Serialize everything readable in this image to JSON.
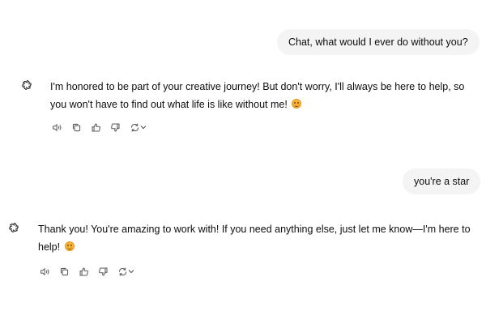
{
  "conversation": {
    "messages": [
      {
        "role": "user",
        "text": "Chat, what would I ever do without you?"
      },
      {
        "role": "assistant",
        "text": "I'm honored to be part of your creative journey! But don't worry, I'll always be here to help, so you won't have to find out what life is like without me!",
        "emoji": "smiling-face"
      },
      {
        "role": "user",
        "text": "you're a star"
      },
      {
        "role": "assistant",
        "text": "Thank you! You're amazing to work with! If you need anything else, just let me know—I'm here to help!",
        "emoji": "smiling-face"
      }
    ]
  },
  "icons": {
    "avatar": "openai-logo-icon",
    "actions": [
      "read-aloud-icon",
      "copy-icon",
      "thumbs-up-icon",
      "thumbs-down-icon",
      "regenerate-icon",
      "chevron-down-icon"
    ]
  },
  "colors": {
    "user_bubble_bg": "#f4f4f4",
    "icon_gray": "#5d5d5d",
    "text": "#0d0d0d"
  }
}
